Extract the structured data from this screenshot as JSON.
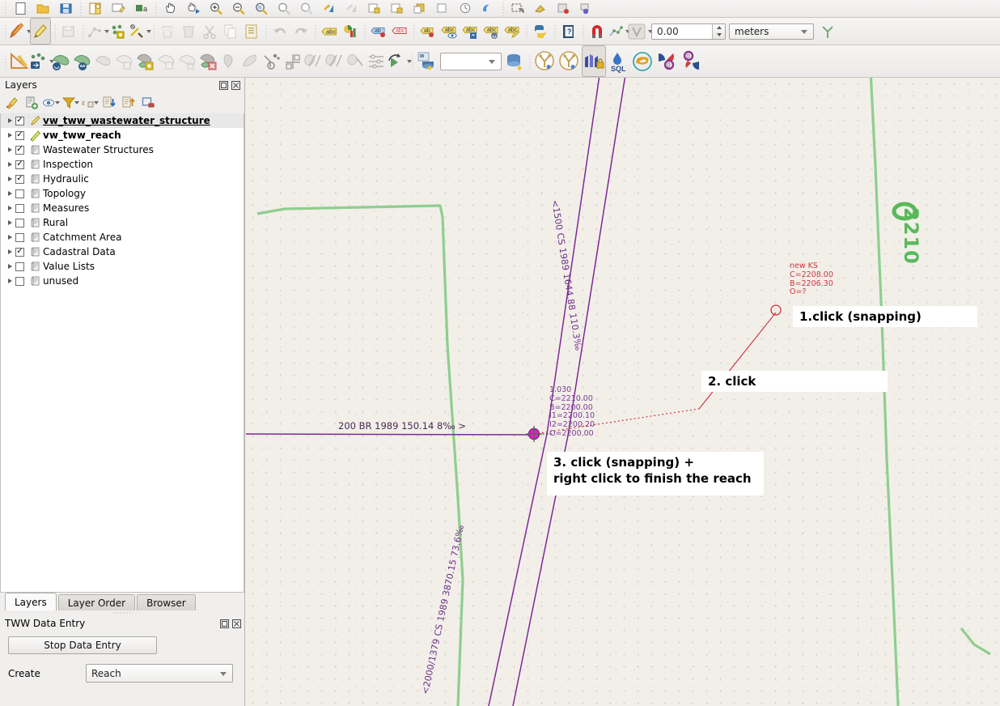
{
  "toolbars": {
    "top_row": [
      {
        "name": "new-project-icon",
        "label": "New Project"
      },
      {
        "name": "open-project-icon",
        "label": "Open Project"
      },
      {
        "name": "save-project-icon",
        "label": "Save Project"
      },
      {
        "name": "new-print-layout-icon",
        "label": "New Print Layout"
      },
      {
        "name": "style-manager-icon",
        "label": "Style Manager"
      },
      {
        "name": "pan-map-icon",
        "label": "Pan Map"
      },
      {
        "name": "pan-to-selection-icon",
        "label": "Pan Map to Selection"
      },
      {
        "name": "zoom-in-icon",
        "label": "Zoom In"
      },
      {
        "name": "zoom-out-icon",
        "label": "Zoom Out"
      },
      {
        "name": "zoom-full-icon",
        "label": "Zoom Full"
      },
      {
        "name": "zoom-to-selection-icon",
        "label": "Zoom To Selection"
      },
      {
        "name": "zoom-to-layer-icon",
        "label": "Zoom To Layer"
      },
      {
        "name": "zoom-last-icon",
        "label": "Zoom Last"
      },
      {
        "name": "zoom-next-icon",
        "label": "Zoom Next"
      },
      {
        "name": "refresh-icon",
        "label": "Refresh"
      },
      {
        "name": "identify-features-icon",
        "label": "Identify Features"
      },
      {
        "name": "select-features-icon",
        "label": "Select Features"
      },
      {
        "name": "deselect-features-icon",
        "label": "Deselect Features"
      },
      {
        "name": "select-value-icon",
        "label": "Select by Value"
      },
      {
        "name": "open-attribute-table-icon",
        "label": "Open Attribute Table"
      },
      {
        "name": "measure-line-icon",
        "label": "Measure Line"
      },
      {
        "name": "show-map-tips-icon",
        "label": "Show Map Tips"
      },
      {
        "name": "new-bookmark-icon",
        "label": "New Bookmark"
      },
      {
        "name": "text-annotation-icon",
        "label": "Text Annotation"
      }
    ],
    "edit_row": [
      {
        "name": "current-edits-icon",
        "label": "Current Edits"
      },
      {
        "name": "toggle-editing-icon",
        "label": "Toggle Editing",
        "active": true
      },
      {
        "name": "save-layer-edits-icon",
        "label": "Save Layer Edits"
      },
      {
        "name": "add-line-feature-icon",
        "label": "Add Line Feature"
      },
      {
        "name": "vertex-tool-icon",
        "label": "Vertex Tool"
      },
      {
        "name": "modify-attributes-icon",
        "label": "Modify Attributes of Selected Features"
      },
      {
        "name": "delete-selected-icon",
        "label": "Delete Selected"
      },
      {
        "name": "cut-features-icon",
        "label": "Cut Features"
      },
      {
        "name": "copy-features-icon",
        "label": "Copy Features"
      },
      {
        "name": "paste-features-icon",
        "label": "Paste Features"
      },
      {
        "name": "undo-icon",
        "label": "Undo"
      },
      {
        "name": "redo-icon",
        "label": "Redo"
      },
      {
        "name": "label-toolbar-icon",
        "label": "Layer Labeling Options"
      },
      {
        "name": "diagram-icon",
        "label": "Layer Diagram Options"
      },
      {
        "name": "highlight-pinned-labels-icon",
        "label": "Highlight Pinned Labels"
      },
      {
        "name": "pin-labels-icon",
        "label": "Pin/Unpin Labels and Diagrams"
      },
      {
        "name": "show-hide-labels-icon",
        "label": "Show/Hide Labels and Diagrams"
      },
      {
        "name": "move-label-icon",
        "label": "Move Label or Diagram"
      },
      {
        "name": "rotate-label-icon",
        "label": "Rotate Label"
      },
      {
        "name": "change-label-icon",
        "label": "Change Label"
      },
      {
        "name": "python-console-icon",
        "label": "Python Console"
      },
      {
        "name": "help-icon",
        "label": "Help"
      },
      {
        "name": "snapping-magnet-icon",
        "label": "Enable Snapping"
      },
      {
        "name": "snapping-mode-icon",
        "label": "Snapping Mode"
      },
      {
        "name": "snapping-type-icon",
        "label": "Snapping Type"
      },
      {
        "name": "avoid-overlap-icon",
        "label": "Avoid Overlap"
      }
    ],
    "edit_row_tolerance": {
      "value": "0.00",
      "units": "meters"
    },
    "digitize_row": [
      {
        "name": "measure-area-icon",
        "label": "Measure Area"
      },
      {
        "name": "move-feature-icon",
        "label": "Move Feature"
      },
      {
        "name": "rotate-feature-icon",
        "label": "Rotate Feature"
      },
      {
        "name": "scale-feature-icon",
        "label": "Scale Feature"
      },
      {
        "name": "simplify-feature-icon",
        "label": "Simplify Feature"
      },
      {
        "name": "add-ring-icon",
        "label": "Add Ring"
      },
      {
        "name": "add-part-icon",
        "label": "Add Part"
      },
      {
        "name": "fill-ring-icon",
        "label": "Fill Ring"
      },
      {
        "name": "delete-ring-icon",
        "label": "Delete Ring"
      },
      {
        "name": "delete-part-icon",
        "label": "Delete Part"
      },
      {
        "name": "reshape-features-icon",
        "label": "Reshape Features"
      },
      {
        "name": "offset-curve-icon",
        "label": "Offset Curve"
      },
      {
        "name": "reverse-line-icon",
        "label": "Reverse Line"
      },
      {
        "name": "trim-extend-icon",
        "label": "Trim/Extend Feature"
      },
      {
        "name": "split-features-icon",
        "label": "Split Features"
      },
      {
        "name": "split-parts-icon",
        "label": "Split Parts"
      },
      {
        "name": "merge-features-icon",
        "label": "Merge Selected Features"
      },
      {
        "name": "merge-attributes-icon",
        "label": "Merge Attributes of Selected Features"
      },
      {
        "name": "rotate-point-symbols-icon",
        "label": "Rotate Point Symbols"
      },
      {
        "name": "processing-toolbox-icon",
        "label": "Processing Toolbox"
      },
      {
        "name": "database-manager-icon",
        "label": "DB Manager"
      },
      {
        "name": "tww-wizard-icon",
        "label": "TWW Wizard"
      },
      {
        "name": "tww-profile-icon",
        "label": "TWW Profile"
      },
      {
        "name": "tww-data-entry-icon",
        "label": "TWW Data Entry",
        "active": true
      },
      {
        "name": "tww-sql-icon",
        "label": "TWW SQL"
      },
      {
        "name": "tww-network-icon",
        "label": "TWW Network"
      },
      {
        "name": "tww-connect-icon",
        "label": "TWW Connect"
      },
      {
        "name": "tww-disconnect-icon",
        "label": "TWW Disconnect"
      }
    ],
    "digitize_row_combo": ""
  },
  "layers_panel": {
    "title": "Layers",
    "dock_buttons": [
      {
        "name": "float-panel-icon",
        "label": "Float"
      },
      {
        "name": "close-panel-icon",
        "label": "Close"
      }
    ],
    "toolbar": [
      {
        "name": "open-layer-styling-icon",
        "label": "Open the Layer Styling panel"
      },
      {
        "name": "add-group-icon",
        "label": "Add Group"
      },
      {
        "name": "manage-visibility-icon",
        "label": "Manage Map Themes"
      },
      {
        "name": "filter-legend-icon",
        "label": "Filter Legend by Map Content"
      },
      {
        "name": "expression-filter-icon",
        "label": "Filter Legend by Expression"
      },
      {
        "name": "collapse-all-icon",
        "label": "Collapse All"
      },
      {
        "name": "expand-all-icon",
        "label": "Expand All"
      },
      {
        "name": "remove-layer-icon",
        "label": "Remove Layer/Group"
      }
    ],
    "items": [
      {
        "label": "vw_tww_wastewater_structure",
        "checked": true,
        "icon": "vector-point-layer-icon",
        "style": "underline",
        "selected": true
      },
      {
        "label": "vw_tww_reach",
        "checked": true,
        "icon": "vector-line-layer-icon",
        "style": "bold",
        "selected": false
      },
      {
        "label": "Wastewater Structures",
        "checked": true,
        "icon": "group-icon",
        "style": "normal",
        "selected": false
      },
      {
        "label": "Inspection",
        "checked": true,
        "icon": "group-icon",
        "style": "normal",
        "selected": false
      },
      {
        "label": "Hydraulic",
        "checked": true,
        "icon": "group-icon",
        "style": "normal",
        "selected": false
      },
      {
        "label": "Topology",
        "checked": false,
        "icon": "group-icon",
        "style": "normal",
        "selected": false
      },
      {
        "label": "Measures",
        "checked": false,
        "icon": "group-icon",
        "style": "normal",
        "selected": false
      },
      {
        "label": "Rural",
        "checked": false,
        "icon": "group-icon",
        "style": "normal",
        "selected": false
      },
      {
        "label": "Catchment Area",
        "checked": false,
        "icon": "group-icon",
        "style": "normal",
        "selected": false
      },
      {
        "label": "Cadastral Data",
        "checked": true,
        "icon": "group-icon",
        "style": "normal",
        "selected": false
      },
      {
        "label": "Value Lists",
        "checked": false,
        "icon": "group-icon",
        "style": "normal",
        "selected": false
      },
      {
        "label": "unused",
        "checked": false,
        "icon": "group-icon",
        "style": "normal",
        "selected": false
      }
    ]
  },
  "panel_tabs": [
    {
      "label": "Layers",
      "active": true
    },
    {
      "label": "Layer Order",
      "active": false
    },
    {
      "label": "Browser",
      "active": false
    }
  ],
  "tww_panel": {
    "title": "TWW Data Entry",
    "dock_buttons": [
      {
        "name": "float-panel-icon",
        "label": "Float"
      },
      {
        "name": "close-panel-icon",
        "label": "Close"
      }
    ],
    "stop_button": "Stop Data Entry",
    "create_label": "Create",
    "create_value": "Reach"
  },
  "map": {
    "reach_labels": [
      {
        "name": "reach-label-upper-left",
        "text": "<1500 CS 1989 1644.88 110.3‰"
      },
      {
        "name": "reach-label-lower-left",
        "text": "<2000/1379 CS 1989 3870.15 73.6‰"
      },
      {
        "name": "reach-label-horizontal",
        "text": "200 BR 1989 150.14 8‰  >"
      }
    ],
    "structure_existing": {
      "name": "existing-structure-label",
      "lines": [
        "1.030",
        "C=2210.00",
        "B=2200.00",
        "I1=2200.10",
        "I2=2200.20",
        "O=2200.00"
      ]
    },
    "structure_new": {
      "name": "new-structure-label",
      "lines": [
        "new KS",
        "C=2208.00",
        "B=2206.30",
        "O=?"
      ]
    },
    "parcel_label": "2210",
    "callouts": [
      {
        "name": "callout-step-1",
        "text": "1.click (snapping)"
      },
      {
        "name": "callout-step-2",
        "text": "2. click"
      },
      {
        "name": "callout-step-3-line1",
        "text": "3. click (snapping) +",
        "text2": "right click to finish the reach"
      }
    ]
  },
  "colors": {
    "reach_purple": "#7d2a93",
    "new_feature_red": "#d0353f",
    "parcel_green": "#8fce8f",
    "label_green": "#59b959",
    "vertex_magenta": "#e020c8",
    "map_background": "#f2efe9"
  }
}
